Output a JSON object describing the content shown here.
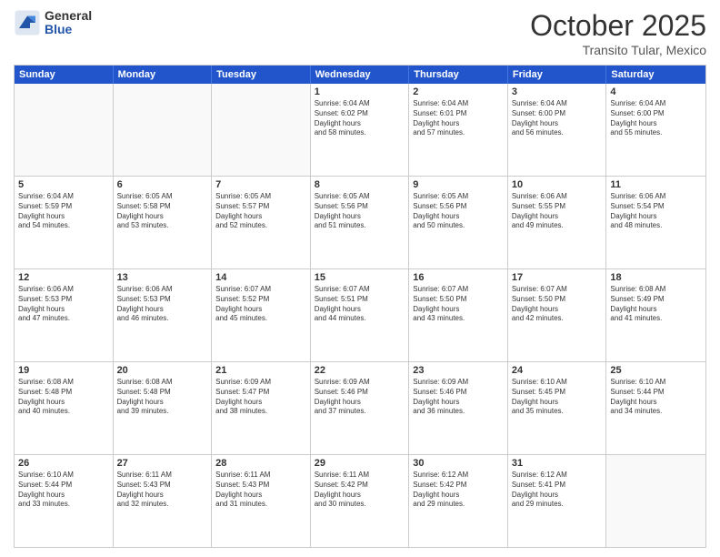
{
  "header": {
    "logo": {
      "general": "General",
      "blue": "Blue"
    },
    "month": "October 2025",
    "location": "Transito Tular, Mexico"
  },
  "days_of_week": [
    "Sunday",
    "Monday",
    "Tuesday",
    "Wednesday",
    "Thursday",
    "Friday",
    "Saturday"
  ],
  "weeks": [
    [
      {
        "day": "",
        "empty": true
      },
      {
        "day": "",
        "empty": true
      },
      {
        "day": "",
        "empty": true
      },
      {
        "day": "1",
        "sunrise": "6:04 AM",
        "sunset": "6:02 PM",
        "daylight": "11 hours and 58 minutes."
      },
      {
        "day": "2",
        "sunrise": "6:04 AM",
        "sunset": "6:01 PM",
        "daylight": "11 hours and 57 minutes."
      },
      {
        "day": "3",
        "sunrise": "6:04 AM",
        "sunset": "6:00 PM",
        "daylight": "11 hours and 56 minutes."
      },
      {
        "day": "4",
        "sunrise": "6:04 AM",
        "sunset": "6:00 PM",
        "daylight": "11 hours and 55 minutes."
      }
    ],
    [
      {
        "day": "5",
        "sunrise": "6:04 AM",
        "sunset": "5:59 PM",
        "daylight": "11 hours and 54 minutes."
      },
      {
        "day": "6",
        "sunrise": "6:05 AM",
        "sunset": "5:58 PM",
        "daylight": "11 hours and 53 minutes."
      },
      {
        "day": "7",
        "sunrise": "6:05 AM",
        "sunset": "5:57 PM",
        "daylight": "11 hours and 52 minutes."
      },
      {
        "day": "8",
        "sunrise": "6:05 AM",
        "sunset": "5:56 PM",
        "daylight": "11 hours and 51 minutes."
      },
      {
        "day": "9",
        "sunrise": "6:05 AM",
        "sunset": "5:56 PM",
        "daylight": "11 hours and 50 minutes."
      },
      {
        "day": "10",
        "sunrise": "6:06 AM",
        "sunset": "5:55 PM",
        "daylight": "11 hours and 49 minutes."
      },
      {
        "day": "11",
        "sunrise": "6:06 AM",
        "sunset": "5:54 PM",
        "daylight": "11 hours and 48 minutes."
      }
    ],
    [
      {
        "day": "12",
        "sunrise": "6:06 AM",
        "sunset": "5:53 PM",
        "daylight": "11 hours and 47 minutes."
      },
      {
        "day": "13",
        "sunrise": "6:06 AM",
        "sunset": "5:53 PM",
        "daylight": "11 hours and 46 minutes."
      },
      {
        "day": "14",
        "sunrise": "6:07 AM",
        "sunset": "5:52 PM",
        "daylight": "11 hours and 45 minutes."
      },
      {
        "day": "15",
        "sunrise": "6:07 AM",
        "sunset": "5:51 PM",
        "daylight": "11 hours and 44 minutes."
      },
      {
        "day": "16",
        "sunrise": "6:07 AM",
        "sunset": "5:50 PM",
        "daylight": "11 hours and 43 minutes."
      },
      {
        "day": "17",
        "sunrise": "6:07 AM",
        "sunset": "5:50 PM",
        "daylight": "11 hours and 42 minutes."
      },
      {
        "day": "18",
        "sunrise": "6:08 AM",
        "sunset": "5:49 PM",
        "daylight": "11 hours and 41 minutes."
      }
    ],
    [
      {
        "day": "19",
        "sunrise": "6:08 AM",
        "sunset": "5:48 PM",
        "daylight": "11 hours and 40 minutes."
      },
      {
        "day": "20",
        "sunrise": "6:08 AM",
        "sunset": "5:48 PM",
        "daylight": "11 hours and 39 minutes."
      },
      {
        "day": "21",
        "sunrise": "6:09 AM",
        "sunset": "5:47 PM",
        "daylight": "11 hours and 38 minutes."
      },
      {
        "day": "22",
        "sunrise": "6:09 AM",
        "sunset": "5:46 PM",
        "daylight": "11 hours and 37 minutes."
      },
      {
        "day": "23",
        "sunrise": "6:09 AM",
        "sunset": "5:46 PM",
        "daylight": "11 hours and 36 minutes."
      },
      {
        "day": "24",
        "sunrise": "6:10 AM",
        "sunset": "5:45 PM",
        "daylight": "11 hours and 35 minutes."
      },
      {
        "day": "25",
        "sunrise": "6:10 AM",
        "sunset": "5:44 PM",
        "daylight": "11 hours and 34 minutes."
      }
    ],
    [
      {
        "day": "26",
        "sunrise": "6:10 AM",
        "sunset": "5:44 PM",
        "daylight": "11 hours and 33 minutes."
      },
      {
        "day": "27",
        "sunrise": "6:11 AM",
        "sunset": "5:43 PM",
        "daylight": "11 hours and 32 minutes."
      },
      {
        "day": "28",
        "sunrise": "6:11 AM",
        "sunset": "5:43 PM",
        "daylight": "11 hours and 31 minutes."
      },
      {
        "day": "29",
        "sunrise": "6:11 AM",
        "sunset": "5:42 PM",
        "daylight": "11 hours and 30 minutes."
      },
      {
        "day": "30",
        "sunrise": "6:12 AM",
        "sunset": "5:42 PM",
        "daylight": "11 hours and 29 minutes."
      },
      {
        "day": "31",
        "sunrise": "6:12 AM",
        "sunset": "5:41 PM",
        "daylight": "11 hours and 29 minutes."
      },
      {
        "day": "",
        "empty": true
      }
    ]
  ],
  "labels": {
    "sunrise": "Sunrise:",
    "sunset": "Sunset:",
    "daylight": "Daylight hours"
  }
}
